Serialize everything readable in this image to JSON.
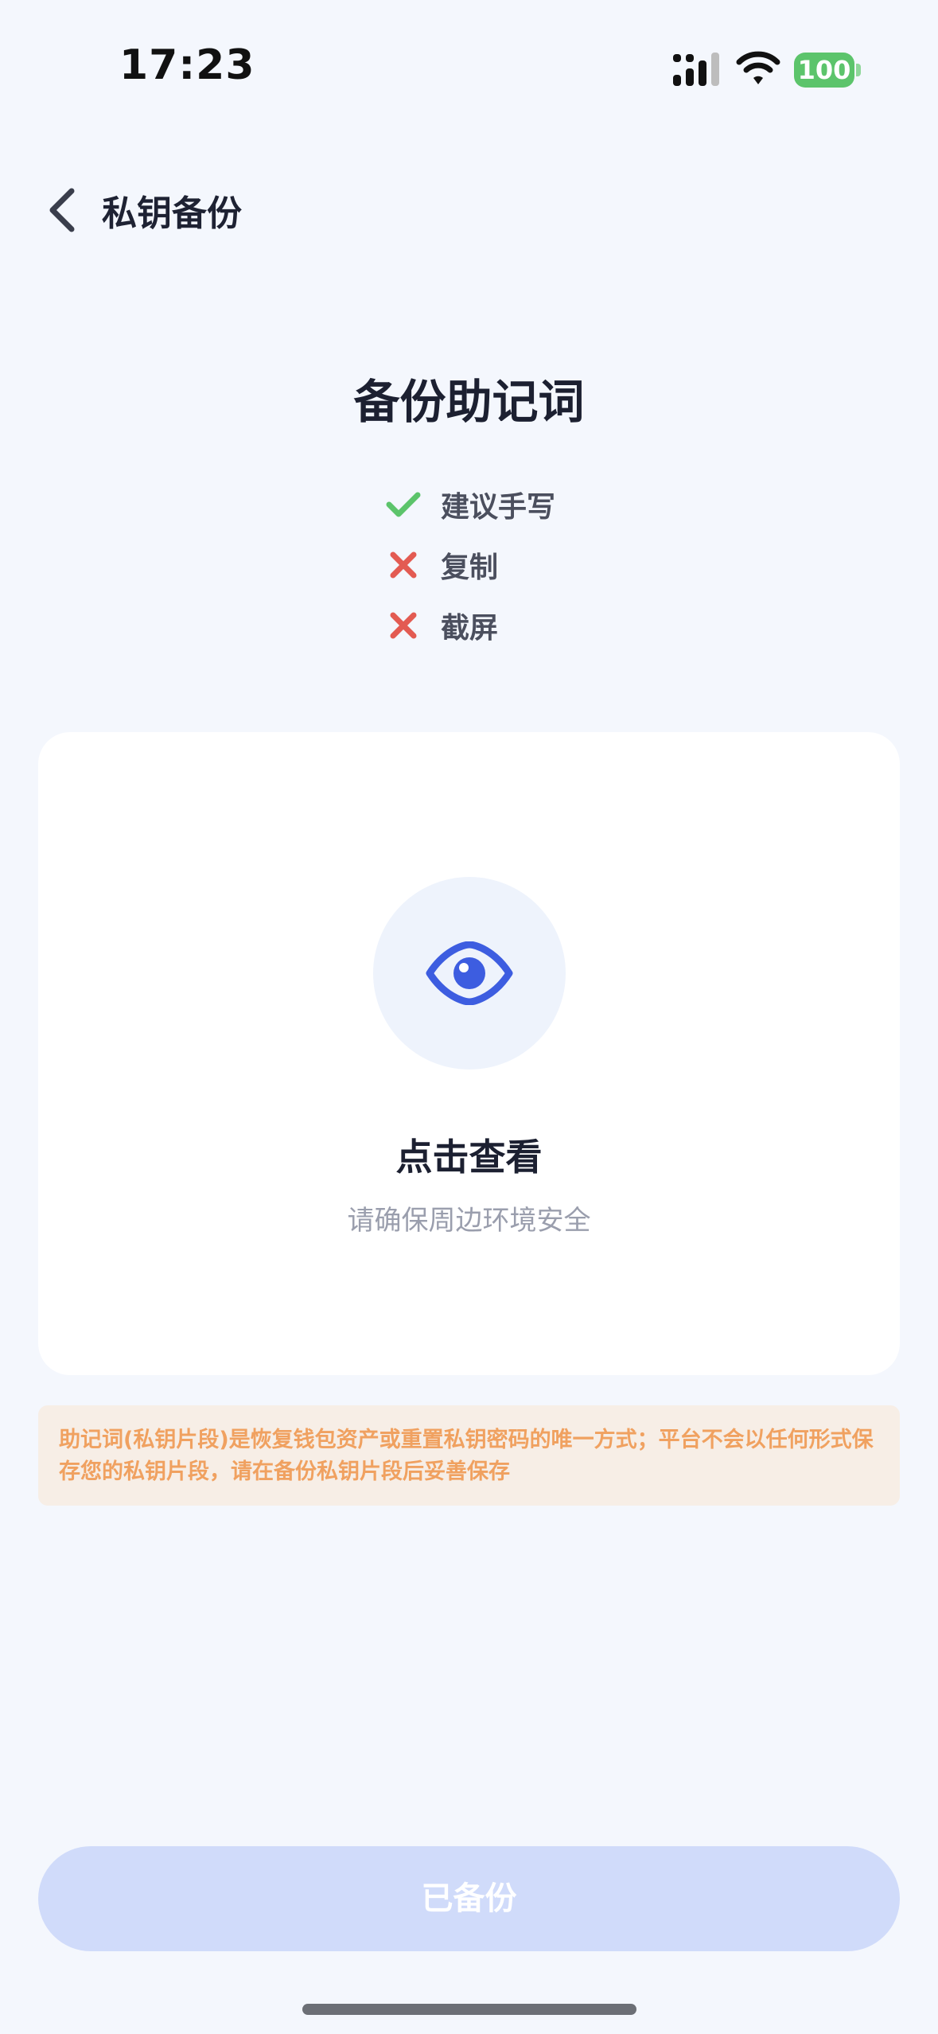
{
  "status_bar": {
    "time": "17:23",
    "battery": "100",
    "battery_color": "#5cc46b"
  },
  "header": {
    "title": "私钥备份"
  },
  "page": {
    "title": "备份助记词",
    "rules": [
      {
        "icon": "check-icon",
        "label": "建议手写",
        "color": "#5cc46b"
      },
      {
        "icon": "cross-icon",
        "label": "复制",
        "color": "#e35b52"
      },
      {
        "icon": "cross-icon",
        "label": "截屏",
        "color": "#e35b52"
      }
    ]
  },
  "reveal_card": {
    "icon": "eye-icon",
    "title": "点击查看",
    "subtitle": "请确保周边环境安全",
    "accent": "#3d5de0"
  },
  "warning": {
    "text": "助记词(私钥片段)是恢复钱包资产或重置私钥密码的唯一方式；平台不会以任何形式保存您的私钥片段，请在备份私钥片段后妥善保存"
  },
  "footer": {
    "button_label": "已备份"
  }
}
